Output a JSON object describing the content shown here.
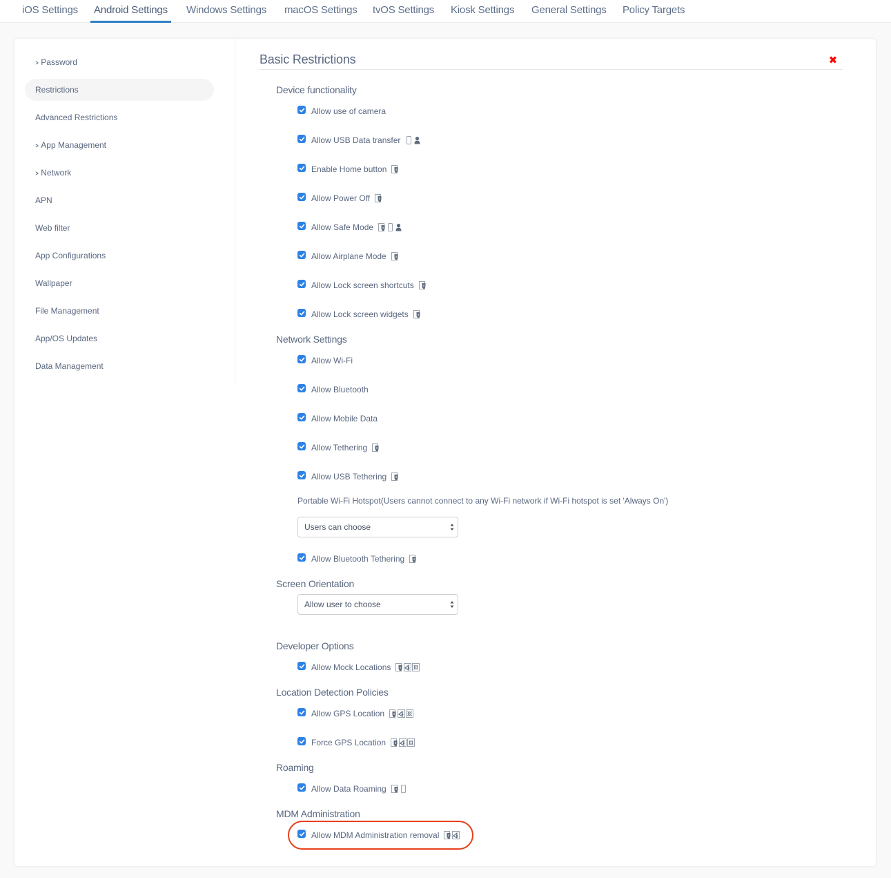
{
  "top_tabs": [
    {
      "label": "iOS Settings",
      "active": false
    },
    {
      "label": "Android Settings",
      "active": true
    },
    {
      "label": "Windows Settings",
      "active": false
    },
    {
      "label": "macOS Settings",
      "active": false
    },
    {
      "label": "tvOS Settings",
      "active": false
    },
    {
      "label": "Kiosk Settings",
      "active": false
    },
    {
      "label": "General Settings",
      "active": false
    },
    {
      "label": "Policy Targets",
      "active": false
    }
  ],
  "sidebar": {
    "items": [
      {
        "label": "Password",
        "expandable": true,
        "active": false
      },
      {
        "label": "Restrictions",
        "expandable": false,
        "active": true
      },
      {
        "label": "Advanced Restrictions",
        "expandable": false,
        "active": false
      },
      {
        "label": "App Management",
        "expandable": true,
        "active": false
      },
      {
        "label": "Network",
        "expandable": true,
        "active": false
      },
      {
        "label": "APN",
        "expandable": false,
        "active": false
      },
      {
        "label": "Web filter",
        "expandable": false,
        "active": false
      },
      {
        "label": "App Configurations",
        "expandable": false,
        "active": false
      },
      {
        "label": "Wallpaper",
        "expandable": false,
        "active": false
      },
      {
        "label": "File Management",
        "expandable": false,
        "active": false
      },
      {
        "label": "App/OS Updates",
        "expandable": false,
        "active": false
      },
      {
        "label": "Data Management",
        "expandable": false,
        "active": false
      }
    ],
    "chevron_glyph": ">"
  },
  "main": {
    "title": "Basic Restrictions",
    "close_glyph": "✖",
    "close_color": "#ff0000",
    "sections": {
      "device_functionality": "Device functionality",
      "network_settings": "Network Settings",
      "screen_orientation": "Screen Orientation",
      "developer_options": "Developer Options",
      "location_detection": "Location Detection Policies",
      "roaming": "Roaming",
      "mdm_administration": "MDM Administration"
    },
    "options": {
      "camera": {
        "label": "Allow use of camera",
        "checked": true,
        "icons": []
      },
      "usb_data": {
        "label": "Allow USB Data transfer",
        "checked": true,
        "icons": [
          "device-icon",
          "user-icon"
        ]
      },
      "home_button": {
        "label": "Enable Home button",
        "checked": true,
        "icons": [
          "shield-icon"
        ]
      },
      "power_off": {
        "label": "Allow Power Off",
        "checked": true,
        "icons": [
          "shield-icon"
        ]
      },
      "safe_mode": {
        "label": "Allow Safe Mode",
        "checked": true,
        "icons": [
          "shield-icon",
          "device-icon",
          "user-icon"
        ]
      },
      "airplane": {
        "label": "Allow Airplane Mode",
        "checked": true,
        "icons": [
          "shield-icon"
        ]
      },
      "lock_shortcuts": {
        "label": "Allow Lock screen shortcuts",
        "checked": true,
        "icons": [
          "shield-icon"
        ]
      },
      "lock_widgets": {
        "label": "Allow Lock screen widgets",
        "checked": true,
        "icons": [
          "shield-icon"
        ]
      },
      "wifi": {
        "label": "Allow Wi-Fi",
        "checked": true,
        "icons": []
      },
      "bluetooth": {
        "label": "Allow Bluetooth",
        "checked": true,
        "icons": []
      },
      "mobile_data": {
        "label": "Allow Mobile Data",
        "checked": true,
        "icons": []
      },
      "tethering": {
        "label": "Allow Tethering",
        "checked": true,
        "icons": [
          "shield-icon"
        ]
      },
      "usb_tethering": {
        "label": "Allow USB Tethering",
        "checked": true,
        "icons": [
          "shield-icon"
        ]
      },
      "bt_tethering": {
        "label": "Allow Bluetooth Tethering",
        "checked": true,
        "icons": [
          "shield-icon"
        ]
      },
      "mock_locations": {
        "label": "Allow Mock Locations",
        "checked": true,
        "icons": [
          "shield-icon",
          "kiosk-icon",
          "settings-icon"
        ]
      },
      "gps_location": {
        "label": "Allow GPS Location",
        "checked": true,
        "icons": [
          "shield-icon",
          "kiosk-icon",
          "settings-icon"
        ]
      },
      "force_gps": {
        "label": "Force GPS Location",
        "checked": true,
        "icons": [
          "shield-icon",
          "kiosk-icon",
          "settings-icon"
        ]
      },
      "data_roaming": {
        "label": "Allow Data Roaming",
        "checked": true,
        "icons": [
          "shield-icon",
          "device-icon"
        ]
      },
      "mdm_removal": {
        "label": "Allow MDM Administration removal",
        "checked": true,
        "icons": [
          "shield-icon",
          "kiosk-icon"
        ],
        "highlighted": true
      }
    },
    "hotspot_note": "Portable Wi-Fi Hotspot(Users cannot connect to any Wi-Fi network if Wi-Fi hotspot is set 'Always On')",
    "hotspot_select": {
      "value": "Users can choose"
    },
    "orientation_select": {
      "value": "Allow user to choose"
    }
  },
  "colors": {
    "accent": "#2e7dc2",
    "checkbox": "#2c82e6",
    "text": "#5a6880",
    "highlight_ring": "#e8401c"
  }
}
